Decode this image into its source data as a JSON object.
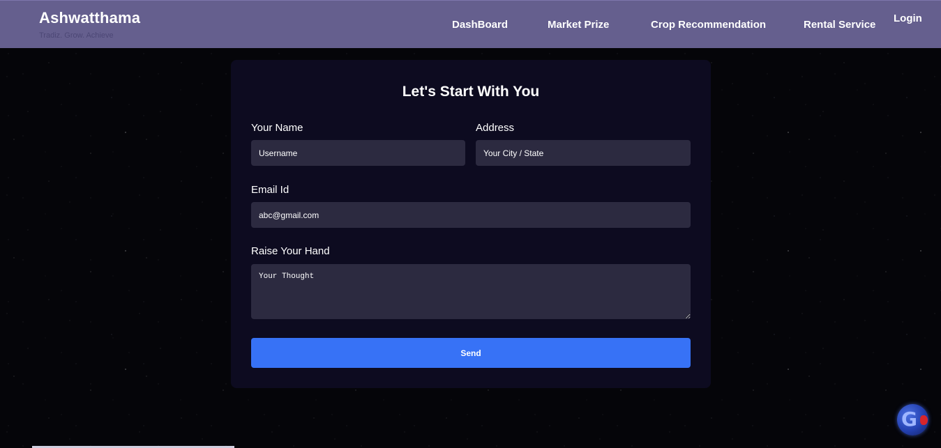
{
  "header": {
    "brand_title": "Ashwatthama",
    "brand_tagline": "Tradiz. Grow. Achieve",
    "nav": {
      "dashboard": "DashBoard",
      "market": "Market Prize",
      "crop": "Crop Recommendation",
      "rental": "Rental Service",
      "login": "Login"
    }
  },
  "form": {
    "title": "Let's Start With You",
    "name_label": "Your Name",
    "name_placeholder": "Username",
    "address_label": "Address",
    "address_placeholder": "Your City / State",
    "email_label": "Email Id",
    "email_placeholder": "abc@gmail.com",
    "hand_label": "Raise Your Hand",
    "hand_placeholder": "Your Thought",
    "send_label": "Send"
  },
  "widget": {
    "icon": "translate-globe-icon",
    "glyph": "G"
  },
  "colors": {
    "header_bg": "#655f8e",
    "card_bg": "#0d0b20",
    "input_bg": "#2c2a40",
    "button_bg": "#3772f6"
  }
}
